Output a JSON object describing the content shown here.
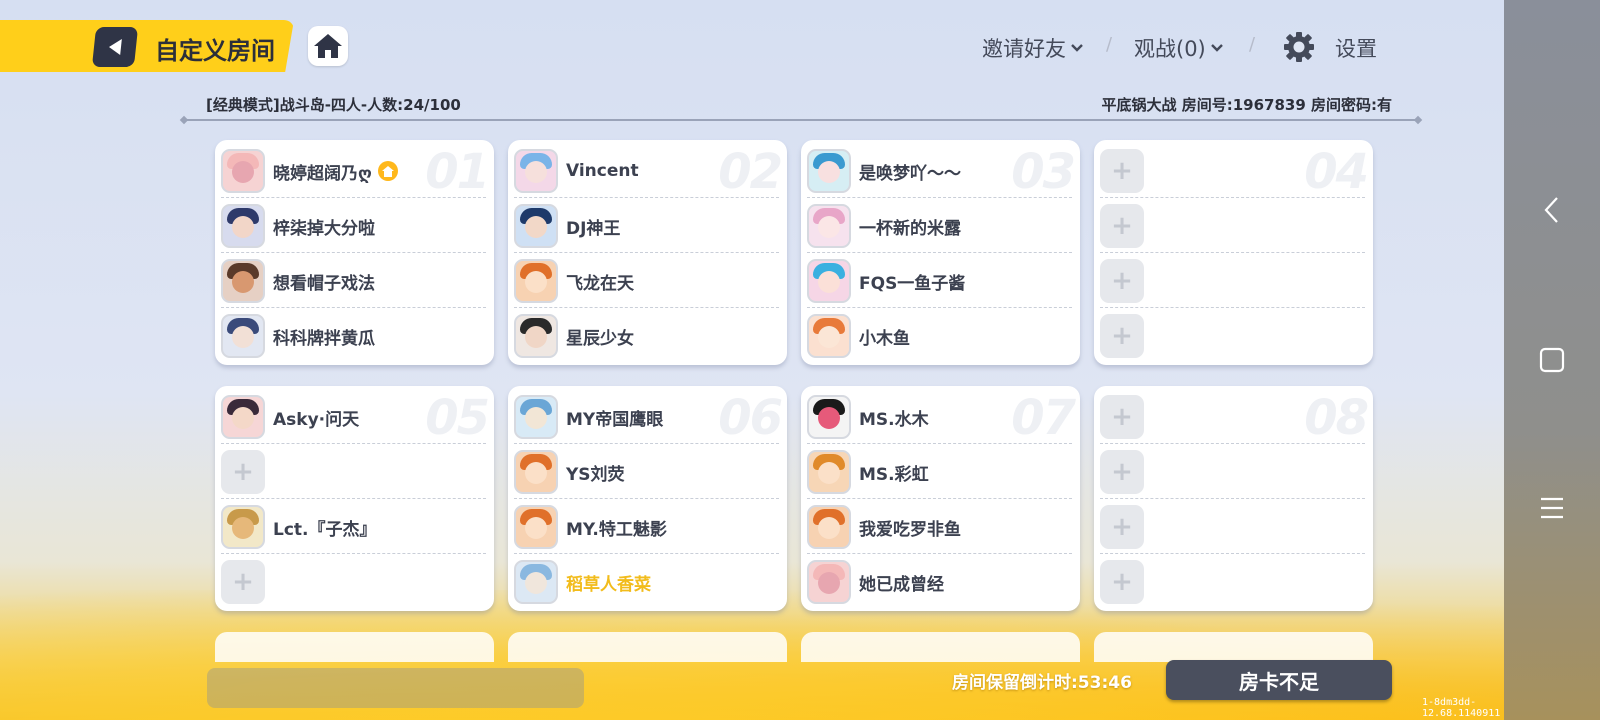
{
  "header": {
    "title": "自定义房间",
    "invite_label": "邀请好友",
    "spectate_label": "观战(0)",
    "settings_label": "设置",
    "slash": "/"
  },
  "room": {
    "mode_info": "[经典模式]战斗岛-四人-人数:24/100",
    "room_info": "平底锅大战 房间号:1967839 房间密码:有"
  },
  "teams": [
    {
      "num": "01",
      "slots": [
        {
          "name": "晓婷超阔乃ღ",
          "host": true
        },
        {
          "name": "梓柒掉大分啦"
        },
        {
          "name": "想看帽子戏法"
        },
        {
          "name": "科科牌拌黄瓜"
        }
      ]
    },
    {
      "num": "02",
      "slots": [
        {
          "name": "Vincent"
        },
        {
          "name": "DJ神王"
        },
        {
          "name": "飞龙在天"
        },
        {
          "name": "星辰少女"
        }
      ]
    },
    {
      "num": "03",
      "slots": [
        {
          "name": "是唤梦吖～～"
        },
        {
          "name": "一杯新的米露"
        },
        {
          "name": "FQS一鱼子酱"
        },
        {
          "name": "小木鱼"
        }
      ]
    },
    {
      "num": "04",
      "slots": [
        {
          "empty": true
        },
        {
          "empty": true
        },
        {
          "empty": true
        },
        {
          "empty": true
        }
      ]
    },
    {
      "num": "05",
      "slots": [
        {
          "name": "Asky·问天"
        },
        {
          "empty": true
        },
        {
          "name": "Lct.『子杰』"
        },
        {
          "empty": true
        }
      ]
    },
    {
      "num": "06",
      "slots": [
        {
          "name": "MY帝国鹰眼"
        },
        {
          "name": "YS刘荧"
        },
        {
          "name": "MY.特工魅影"
        },
        {
          "name": "稻草人香菜",
          "highlight": true
        }
      ]
    },
    {
      "num": "07",
      "slots": [
        {
          "name": "MS.水木"
        },
        {
          "name": "MS.彩虹"
        },
        {
          "name": "我爱吃罗非鱼"
        },
        {
          "name": "她已成曾经"
        }
      ]
    },
    {
      "num": "08",
      "slots": [
        {
          "empty": true
        },
        {
          "empty": true
        },
        {
          "empty": true
        },
        {
          "empty": true
        }
      ]
    }
  ],
  "empty_slot_symbol": "+",
  "footer": {
    "countdown": "房间保留倒计时:53:46",
    "room_card_button": "房卡不足",
    "build": "1-8dm3dd-12.68.1140911"
  },
  "colors": {
    "accent_yellow": "#ffcf1a",
    "dark_button": "#4a4f5e",
    "highlight_name": "#f2bc1c",
    "host_crown": "#ffb81c"
  }
}
